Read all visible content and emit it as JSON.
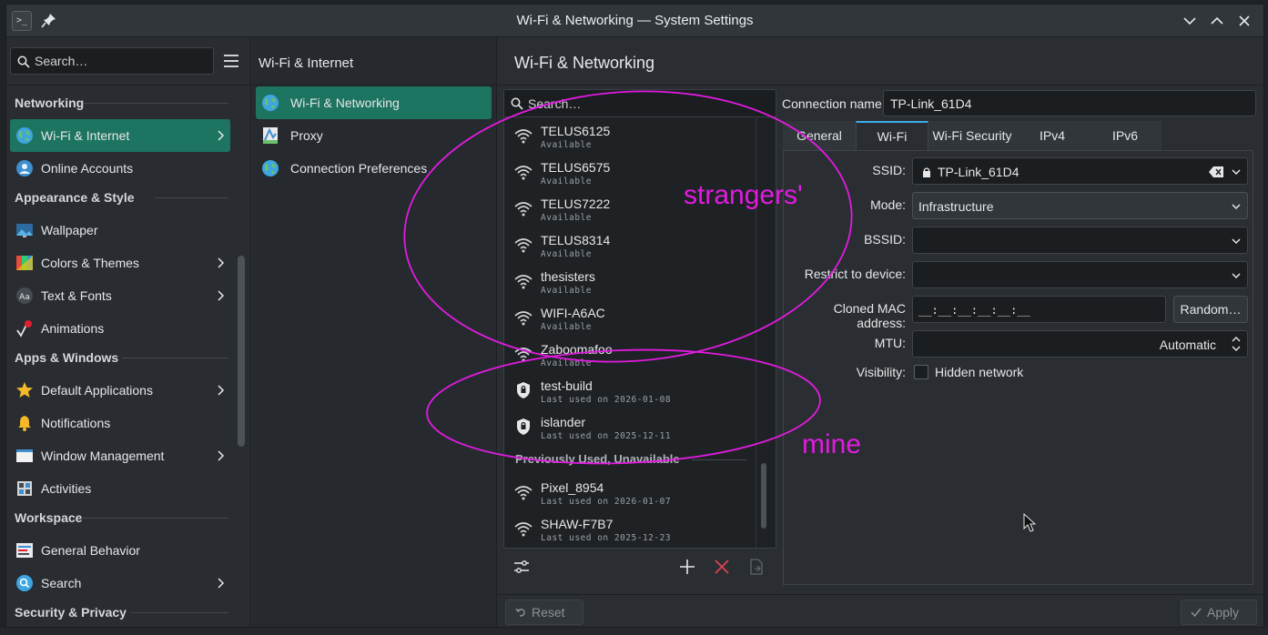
{
  "window": {
    "title": "Wi-Fi & Networking — System Settings"
  },
  "sidebar": {
    "search_placeholder": "Search…",
    "sections": [
      {
        "title": "Networking",
        "items": [
          {
            "label": "Wi-Fi & Internet",
            "icon": "globe-icon",
            "chevron": true,
            "active": true
          },
          {
            "label": "Online Accounts",
            "icon": "online-accounts-icon",
            "chevron": false
          }
        ]
      },
      {
        "title": "Appearance & Style",
        "items": [
          {
            "label": "Wallpaper",
            "icon": "wallpaper-icon",
            "chevron": false
          },
          {
            "label": "Colors & Themes",
            "icon": "palette-icon",
            "chevron": true
          },
          {
            "label": "Text & Fonts",
            "icon": "fonts-icon",
            "chevron": true
          },
          {
            "label": "Animations",
            "icon": "animations-icon",
            "chevron": false
          }
        ]
      },
      {
        "title": "Apps & Windows",
        "items": [
          {
            "label": "Default Applications",
            "icon": "star-icon",
            "chevron": true
          },
          {
            "label": "Notifications",
            "icon": "bell-icon",
            "chevron": false
          },
          {
            "label": "Window Management",
            "icon": "window-icon",
            "chevron": true
          },
          {
            "label": "Activities",
            "icon": "activities-icon",
            "chevron": false
          }
        ]
      },
      {
        "title": "Workspace",
        "items": [
          {
            "label": "General Behavior",
            "icon": "general-behavior-icon",
            "chevron": false
          },
          {
            "label": "Search",
            "icon": "search-icon",
            "chevron": true
          }
        ]
      },
      {
        "title": "Security & Privacy",
        "items": []
      }
    ]
  },
  "midcol": {
    "header": "Wi-Fi & Internet",
    "items": [
      {
        "label": "Wi-Fi & Networking",
        "icon": "globe-icon",
        "active": true
      },
      {
        "label": "Proxy",
        "icon": "proxy-icon",
        "active": false
      },
      {
        "label": "Connection Preferences",
        "icon": "globe-icon",
        "active": false
      }
    ]
  },
  "main": {
    "header": "Wi-Fi & Networking",
    "connections": {
      "search_placeholder": "Search…",
      "available": [
        {
          "name": "TELUS6125",
          "status": "Available"
        },
        {
          "name": "TELUS6575",
          "status": "Available"
        },
        {
          "name": "TELUS7222",
          "status": "Available"
        },
        {
          "name": "TELUS8314",
          "status": "Available"
        },
        {
          "name": "thesisters",
          "status": "Available"
        },
        {
          "name": "WIFI-A6AC",
          "status": "Available"
        },
        {
          "name": "Zaboomafoo",
          "status": "Available"
        }
      ],
      "mine": [
        {
          "name": "test-build",
          "status": "Last used on 2026-01-08"
        },
        {
          "name": "islander",
          "status": "Last used on 2025-12-11"
        }
      ],
      "unavailable_header": "Previously Used, Unavailable",
      "unavailable": [
        {
          "name": "Pixel_8954",
          "status": "Last used on 2026-01-07"
        },
        {
          "name": "SHAW-F7B7",
          "status": "Last used on 2025-12-23"
        }
      ]
    },
    "connection_name_label": "Connection name:",
    "connection_name_value": "TP-Link_61D4",
    "tabs": [
      "General",
      "Wi-Fi",
      "Wi-Fi Security",
      "IPv4",
      "IPv6"
    ],
    "active_tab": "Wi-Fi",
    "form": {
      "ssid_label": "SSID:",
      "ssid_value": "TP-Link_61D4",
      "mode_label": "Mode:",
      "mode_value": "Infrastructure",
      "bssid_label": "BSSID:",
      "bssid_value": "",
      "restrict_label": "Restrict to device:",
      "restrict_value": "",
      "mac_label": "Cloned MAC address:",
      "mac_value": "__:__:__:__:__:__",
      "random_label": "Random…",
      "mtu_label": "MTU:",
      "mtu_value": "Automatic",
      "visibility_label": "Visibility:",
      "hidden_label": "Hidden network",
      "hidden_checked": false
    },
    "reset_label": "Reset",
    "apply_label": "Apply"
  },
  "annotations": {
    "strangers": "strangers'",
    "mine": "mine",
    "color": "#e21be1"
  },
  "colors": {
    "accent": "#1d7460",
    "focus": "#3daee9",
    "delete": "#da4453"
  }
}
